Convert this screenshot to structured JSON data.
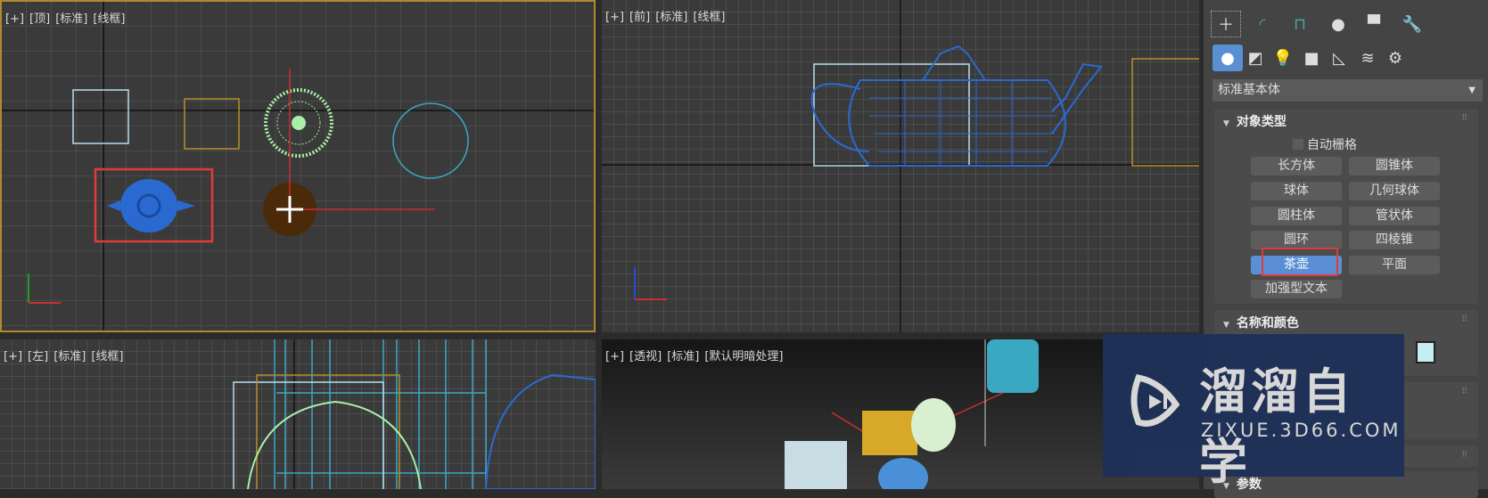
{
  "viewports": {
    "top": {
      "plus": "[+]",
      "view": "[顶]",
      "mode": "[标准]",
      "shading": "[线框]"
    },
    "front": {
      "plus": "[+]",
      "view": "[前]",
      "mode": "[标准]",
      "shading": "[线框]"
    },
    "left": {
      "plus": "[+]",
      "view": "[左]",
      "mode": "[标准]",
      "shading": "[线框]"
    },
    "perspective": {
      "plus": "[+]",
      "view": "[透视]",
      "mode": "[标准]",
      "shading": "[默认明暗处理]"
    }
  },
  "panel": {
    "tabs": [
      "create-icon",
      "modify-icon",
      "hierarchy-icon",
      "motion-icon",
      "display-icon",
      "utilities-icon"
    ],
    "categories": [
      "geometry-icon",
      "shapes-icon",
      "lights-icon",
      "cameras-icon",
      "helpers-icon",
      "spacewarps-icon",
      "systems-icon"
    ],
    "dropdown": "标准基本体",
    "object_type": {
      "title": "对象类型",
      "autogrid": "自动栅格",
      "buttons": [
        "长方体",
        "圆锥体",
        "球体",
        "几何球体",
        "圆柱体",
        "管状体",
        "圆环",
        "四棱锥",
        "茶壶",
        "平面",
        "加强型文本"
      ],
      "active": "茶壶"
    },
    "name_color": {
      "title": "名称和颜色",
      "color": "#c8ecf4"
    },
    "params": {
      "title": "参数"
    }
  },
  "watermark": {
    "brand": "溜溜自学",
    "url": "ZIXUE.3D66.COM"
  },
  "colors": {
    "accent": "#5b8fd4",
    "highlight": "#e03a3a",
    "active_border": "#b08a2e"
  }
}
